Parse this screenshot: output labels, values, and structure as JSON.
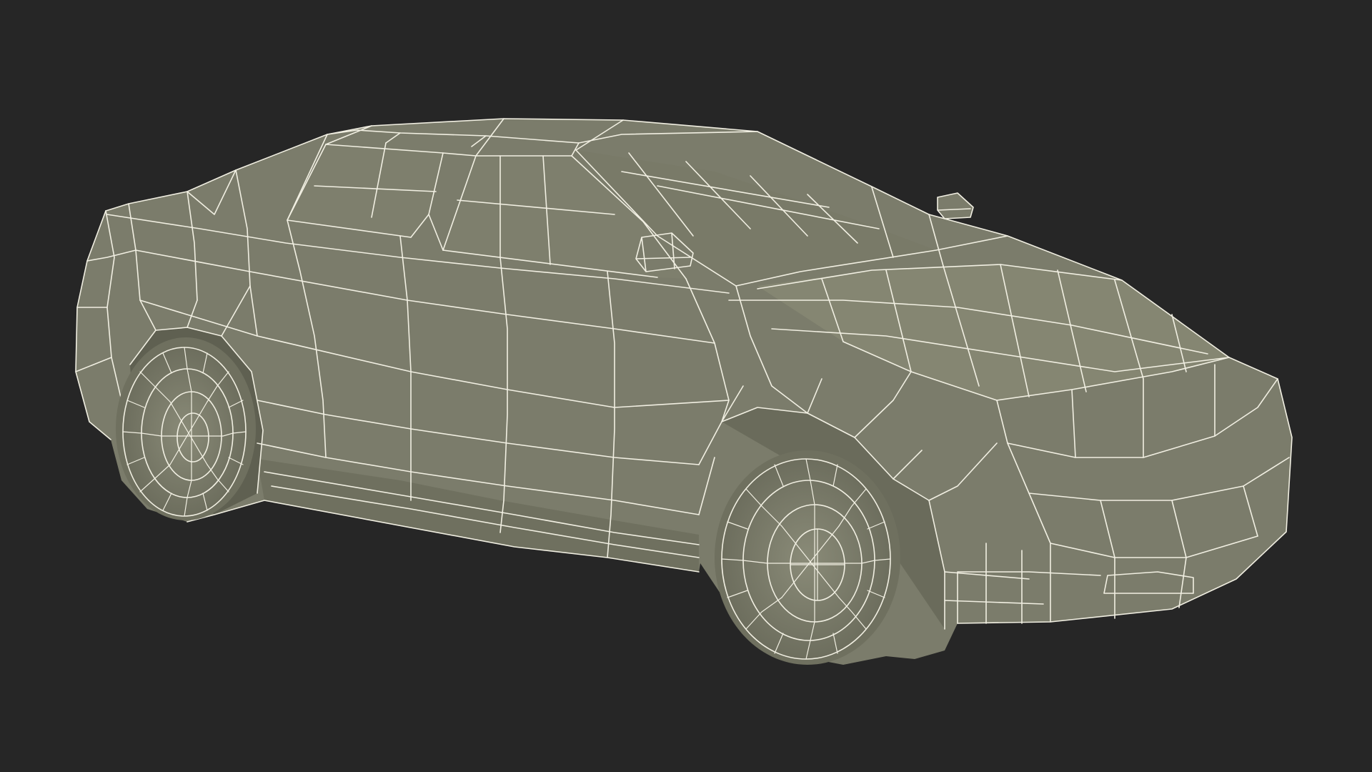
{
  "scene": {
    "subject": "car",
    "render_mode": "wireframe-over-shaded"
  },
  "colors": {
    "background": "#262626",
    "body": "#7b7c6b",
    "body_shadow": "#6a6b5b",
    "body_light": "#8a8b78",
    "wire": "#f1efe2"
  }
}
